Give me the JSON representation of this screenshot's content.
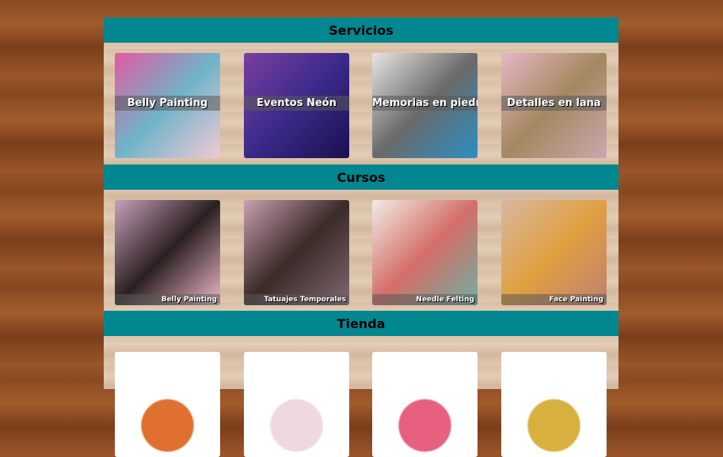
{
  "sections": [
    {
      "title": "Servicios",
      "items": [
        {
          "label": "Belly Painting",
          "colors": [
            "#e25aa0",
            "#6fb3c9",
            "#f1c9d6"
          ]
        },
        {
          "label": "Eventos Neón",
          "colors": [
            "#7a3fa0",
            "#3b2a8a",
            "#1a1050"
          ]
        },
        {
          "label": "Memorias en piedra",
          "colors": [
            "#e8e6e4",
            "#6a6a6a",
            "#2a8fc4"
          ]
        },
        {
          "label": "Detalles en lana",
          "colors": [
            "#e7b6c6",
            "#a48860",
            "#c9a8b0"
          ]
        }
      ]
    },
    {
      "title": "Cursos",
      "items": [
        {
          "label": "Belly Painting",
          "colors": [
            "#c7a0bc",
            "#2a2020",
            "#f0b8c8"
          ]
        },
        {
          "label": "Tatuajes Temporales",
          "colors": [
            "#c9a0b0",
            "#3a2a28",
            "#806a70"
          ]
        },
        {
          "label": "Needle Felting",
          "colors": [
            "#f2ece6",
            "#d46e68",
            "#6fb0a0"
          ]
        },
        {
          "label": "Face Painting",
          "colors": [
            "#d8b8a0",
            "#e0a040",
            "#c08070"
          ]
        }
      ]
    },
    {
      "title": "Tienda",
      "items": [
        {
          "label": "",
          "colors": [
            "#fff",
            "#e07030",
            "#fff"
          ]
        },
        {
          "label": "",
          "colors": [
            "#fff",
            "#f0d8e0",
            "#fff"
          ]
        },
        {
          "label": "",
          "colors": [
            "#fff",
            "#e86080",
            "#fff"
          ]
        },
        {
          "label": "",
          "colors": [
            "#fff",
            "#d8b040",
            "#fff"
          ]
        }
      ]
    }
  ],
  "accent": "#00878f"
}
